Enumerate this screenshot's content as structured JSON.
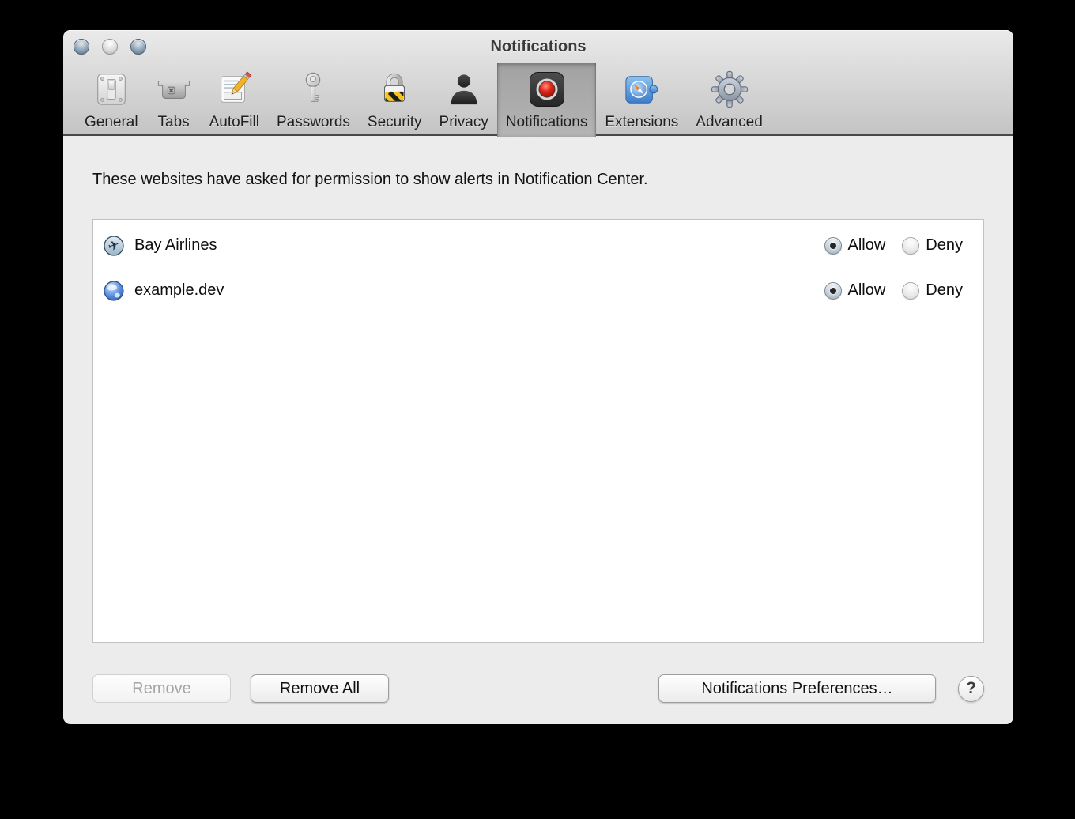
{
  "window": {
    "title": "Notifications"
  },
  "traffic_lights": {
    "close": "close-button",
    "minimize": "minimize-button",
    "zoom": "zoom-button"
  },
  "toolbar": {
    "items": [
      {
        "label": "General",
        "icon": "light-switch-icon",
        "selected": false
      },
      {
        "label": "Tabs",
        "icon": "tab-icon",
        "selected": false
      },
      {
        "label": "AutoFill",
        "icon": "pencil-form-icon",
        "selected": false
      },
      {
        "label": "Passwords",
        "icon": "key-icon",
        "selected": false
      },
      {
        "label": "Security",
        "icon": "padlock-icon",
        "selected": false
      },
      {
        "label": "Privacy",
        "icon": "person-icon",
        "selected": false
      },
      {
        "label": "Notifications",
        "icon": "record-dot-icon",
        "selected": true
      },
      {
        "label": "Extensions",
        "icon": "puzzle-compass-icon",
        "selected": false
      },
      {
        "label": "Advanced",
        "icon": "gear-icon",
        "selected": false
      }
    ]
  },
  "description": "These websites have asked for permission to show alerts in Notification Center.",
  "permissions": {
    "rows": [
      {
        "site": "Bay Airlines",
        "icon": "airplane-favicon",
        "choice": "allow",
        "allow_label": "Allow",
        "deny_label": "Deny"
      },
      {
        "site": "example.dev",
        "icon": "globe-favicon",
        "choice": "allow",
        "allow_label": "Allow",
        "deny_label": "Deny"
      }
    ]
  },
  "footer": {
    "remove_label": "Remove",
    "remove_enabled": false,
    "remove_all_label": "Remove All",
    "preferences_label": "Notifications Preferences…",
    "help_label": "?"
  },
  "colors": {
    "notification_red": "#d81e12",
    "selected_tab_bg": "#a8a8a8",
    "window_bg": "#ececec",
    "chrome_top": "#eaeaea",
    "chrome_bottom": "#c4c4c4"
  }
}
